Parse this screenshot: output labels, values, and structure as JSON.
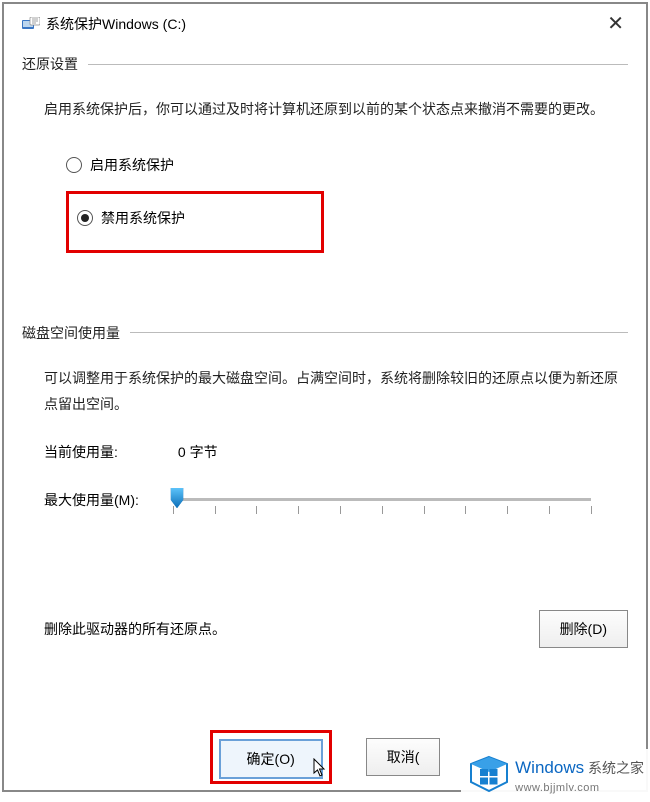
{
  "titlebar": {
    "title": "系统保护Windows (C:)"
  },
  "restore": {
    "section_title": "还原设置",
    "description": "启用系统保护后，你可以通过及时将计算机还原到以前的某个状态点来撤消不需要的更改。",
    "radio_enable": "启用系统保护",
    "radio_disable": "禁用系统保护"
  },
  "disk": {
    "section_title": "磁盘空间使用量",
    "description": "可以调整用于系统保护的最大磁盘空间。占满空间时，系统将删除较旧的还原点以便为新还原点留出空间。",
    "current_label": "当前使用量:",
    "current_value": "0 字节",
    "max_label": "最大使用量(M):"
  },
  "delete": {
    "text": "删除此驱动器的所有还原点。",
    "button": "删除(D)"
  },
  "buttons": {
    "ok": "确定(O)",
    "cancel": "取消("
  },
  "watermark": {
    "main": "Windows",
    "sub": "系统之家",
    "url": "www.bjjmlv.com"
  }
}
